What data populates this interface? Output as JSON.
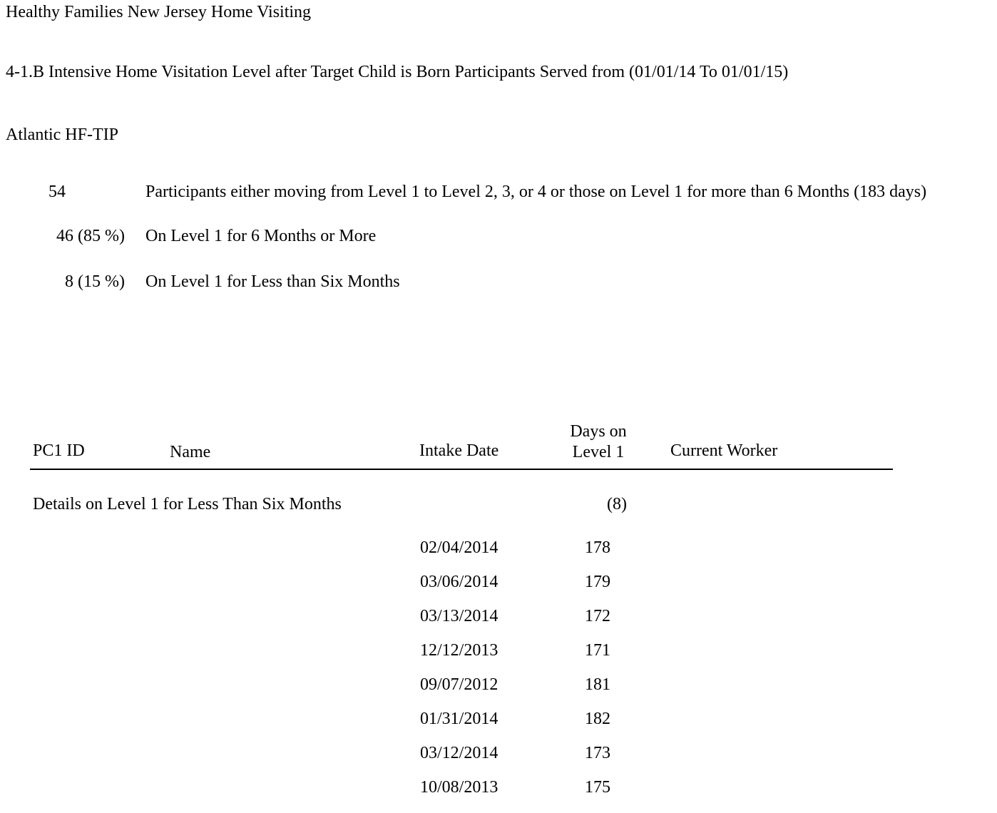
{
  "header": {
    "organization": "Healthy Families New Jersey Home Visiting",
    "report_title": "4-1.B Intensive Home Visitation Level after Target Child is Born Participants Served from (01/01/14 To 01/01/15)",
    "site": "Atlantic HF-TIP"
  },
  "summary": [
    {
      "count": "54",
      "description": "Participants either moving from Level 1 to Level 2, 3, or 4 or those on Level 1 for more than 6 Months (183 days)"
    },
    {
      "count": "46 (85 %)",
      "description": "On Level 1 for 6 Months or More"
    },
    {
      "count": "8 (15 %)",
      "description": "On Level 1 for Less than Six Months"
    }
  ],
  "table": {
    "columns": {
      "pc1_id": "PC1 ID",
      "name": "Name",
      "intake_date": "Intake Date",
      "days_on_level_1": "Days on Level 1",
      "current_worker": "Current Worker"
    },
    "group": {
      "label": "Details on Level 1 for Less Than Six Months",
      "count": "(8)"
    },
    "rows": [
      {
        "intake_date": "02/04/2014",
        "days": "178"
      },
      {
        "intake_date": "03/06/2014",
        "days": "179"
      },
      {
        "intake_date": "03/13/2014",
        "days": "172"
      },
      {
        "intake_date": "12/12/2013",
        "days": "171"
      },
      {
        "intake_date": "09/07/2012",
        "days": "181"
      },
      {
        "intake_date": "01/31/2014",
        "days": "182"
      },
      {
        "intake_date": "03/12/2014",
        "days": "173"
      },
      {
        "intake_date": "10/08/2013",
        "days": "175"
      }
    ]
  }
}
